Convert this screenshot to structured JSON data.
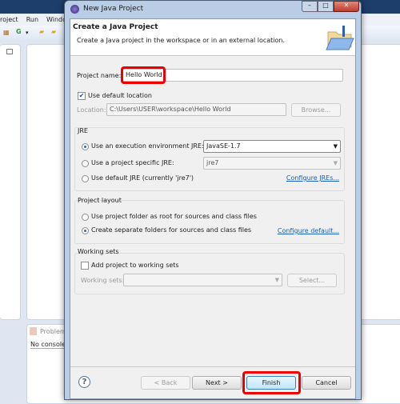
{
  "eclipse": {
    "menu": [
      "roject",
      "Run",
      "Window"
    ],
    "problems_tab": "Problem",
    "console_text": "No console"
  },
  "dialog": {
    "window_title": "New Java Project",
    "header_title": "Create a Java Project",
    "header_desc": "Create a Java project in the workspace or in an external location.",
    "project_name_label": "Project name:",
    "project_name_value": "Hello World",
    "use_default_location_label": "Use default location",
    "use_default_location_checked": true,
    "location_label": "Location:",
    "location_value": "C:\\Users\\USER\\workspace\\Hello World",
    "browse_label": "Browse...",
    "jre": {
      "group_label": "JRE",
      "options": [
        {
          "label": "Use an execution environment JRE:",
          "selected": true
        },
        {
          "label": "Use a project specific JRE:",
          "selected": false
        },
        {
          "label": "Use default JRE (currently 'jre7')",
          "selected": false
        }
      ],
      "env_value": "JavaSE-1.7",
      "specific_value": "jre7",
      "configure_link": "Configure JREs..."
    },
    "layout": {
      "group_label": "Project layout",
      "options": [
        {
          "label": "Use project folder as root for sources and class files",
          "selected": false
        },
        {
          "label": "Create separate folders for sources and class files",
          "selected": true
        }
      ],
      "configure_link": "Configure default..."
    },
    "working_sets": {
      "group_label": "Working sets",
      "add_label": "Add project to working sets",
      "add_checked": false,
      "sets_label": "Working sets:",
      "select_label": "Select..."
    },
    "buttons": {
      "back": "< Back",
      "next": "Next >",
      "finish": "Finish",
      "cancel": "Cancel"
    },
    "highlight_color": "#ee0000"
  }
}
